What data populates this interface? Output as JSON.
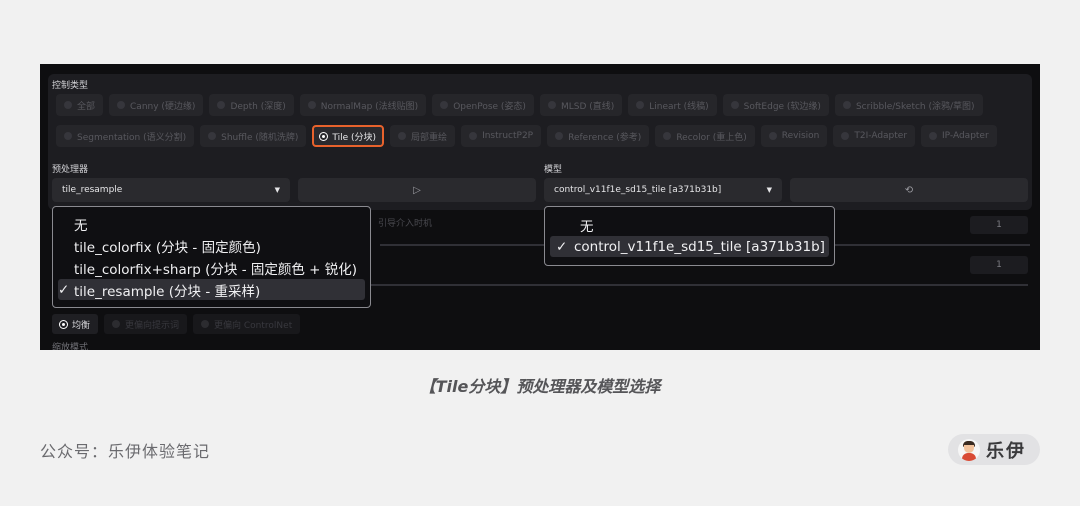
{
  "control_type": {
    "label": "控制类型",
    "row1": [
      "全部",
      "Canny (硬边缘)",
      "Depth (深度)",
      "NormalMap (法线贴图)",
      "OpenPose (姿态)",
      "MLSD (直线)",
      "Lineart (线稿)",
      "SoftEdge (软边缘)",
      "Scribble/Sketch (涂鸦/草图)"
    ],
    "row2": [
      "Segmentation (语义分割)",
      "Shuffle (随机洗牌)",
      "Tile (分块)",
      "局部重绘",
      "InstructP2P",
      "Reference (参考)",
      "Recolor (重上色)",
      "Revision",
      "T2I-Adapter",
      "IP-Adapter"
    ],
    "selected": "Tile (分块)"
  },
  "preprocessor": {
    "label": "预处理器",
    "value": "tile_resample",
    "run_icon": "▷",
    "menu": [
      {
        "text": "无",
        "checked": false
      },
      {
        "text": "tile_colorfix (分块 - 固定颜色)",
        "checked": false
      },
      {
        "text": "tile_colorfix+sharp (分块 - 固定颜色 + 锐化)",
        "checked": false
      },
      {
        "text": "tile_resample (分块 - 重采样)",
        "checked": true
      }
    ],
    "check_mark": "✓"
  },
  "model": {
    "label": "模型",
    "value": "control_v11f1e_sd15_tile [a371b31b]",
    "refresh_icon": "⟲",
    "menu": [
      {
        "text": "无",
        "checked": false
      },
      {
        "text": "control_v11f1e_sd15_tile [a371b31b]",
        "checked": true
      }
    ]
  },
  "hidden": {
    "timing_label": "引导介入时机",
    "value1": "1",
    "value2": "1"
  },
  "control_mode": {
    "options": [
      "均衡",
      "更偏向提示词",
      "更偏向 ControlNet"
    ],
    "selected": "均衡"
  },
  "resize_label": "缩放模式",
  "caption": "【Tile分块】预处理器及模型选择",
  "footer": "公众号：乐伊体验笔记",
  "author": "乐伊",
  "colors": {
    "accent": "#e8622c",
    "panel": "#1d1d21",
    "page": "#f1f1f1"
  }
}
